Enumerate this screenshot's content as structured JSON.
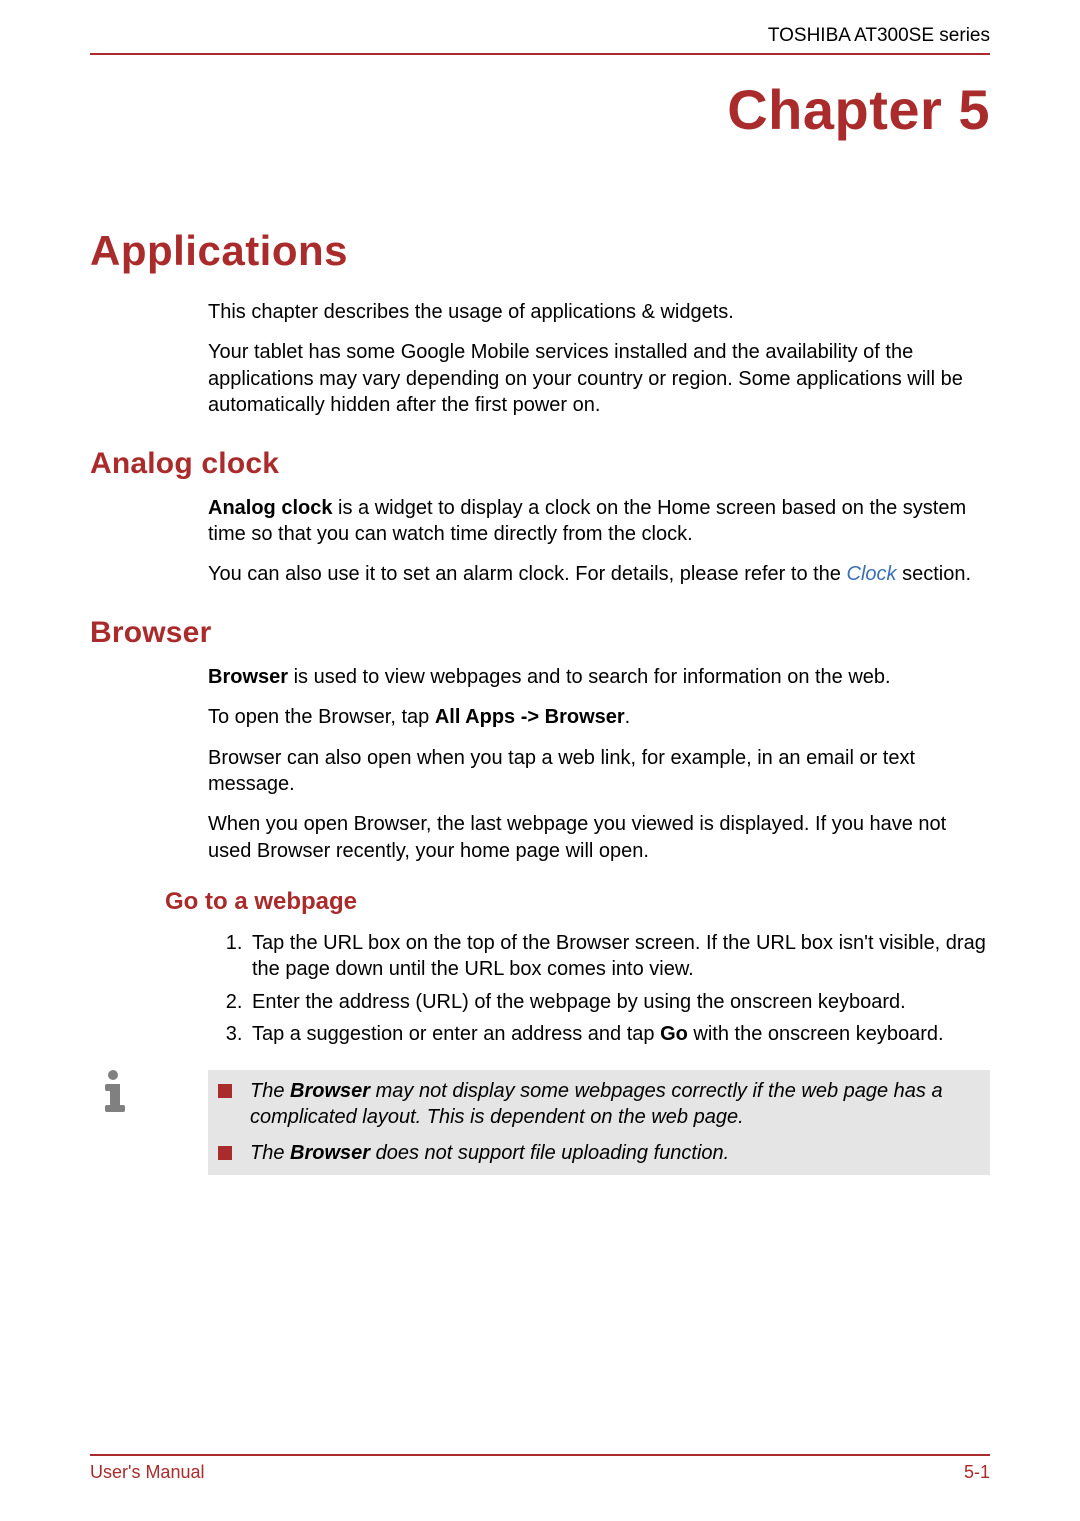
{
  "header": {
    "product": "TOSHIBA AT300SE series"
  },
  "chapter": {
    "label": "Chapter 5"
  },
  "title": "Applications",
  "intro": {
    "p1": "This chapter describes the usage of applications & widgets.",
    "p2": "Your tablet has some Google Mobile services installed and the availability of the applications may vary depending on your country or region. Some applications will be automatically hidden after the first power on."
  },
  "analog": {
    "heading": "Analog clock",
    "p1_bold": "Analog clock",
    "p1_rest": " is a widget to display a clock on the Home screen based on the system time so that you can watch time directly from the clock.",
    "p2_a": "You can also use it to set an alarm clock. For details, please refer to the ",
    "p2_link": "Clock",
    "p2_b": " section."
  },
  "browser": {
    "heading": "Browser",
    "p1_bold": "Browser",
    "p1_rest": " is used to view webpages and to search for information on the web.",
    "p2_a": "To open the Browser, tap ",
    "p2_bold": "All Apps -> Browser",
    "p2_b": ".",
    "p3": "Browser can also open when you tap a web link, for example, in an email or text message.",
    "p4": "When you open Browser, the last webpage you viewed is displayed. If you have not used Browser recently, your home page will open."
  },
  "goto": {
    "heading": "Go to a webpage",
    "step1": "Tap the URL box on the top of the Browser screen. If the URL box isn't visible, drag the page down until the URL box comes into view.",
    "step2": "Enter the address (URL) of the webpage by using the onscreen keyboard.",
    "step3_a": "Tap a suggestion or enter an address and tap ",
    "step3_bold": "Go",
    "step3_b": " with the onscreen keyboard."
  },
  "notes": {
    "n1_a": "The ",
    "n1_bold": "Browser",
    "n1_b": " may not display some webpages correctly if the web page has a complicated layout. This is dependent on the web page.",
    "n2_a": "The ",
    "n2_bold": "Browser",
    "n2_b": " does not support file uploading function."
  },
  "footer": {
    "left": "User's Manual",
    "right": "5-1"
  }
}
